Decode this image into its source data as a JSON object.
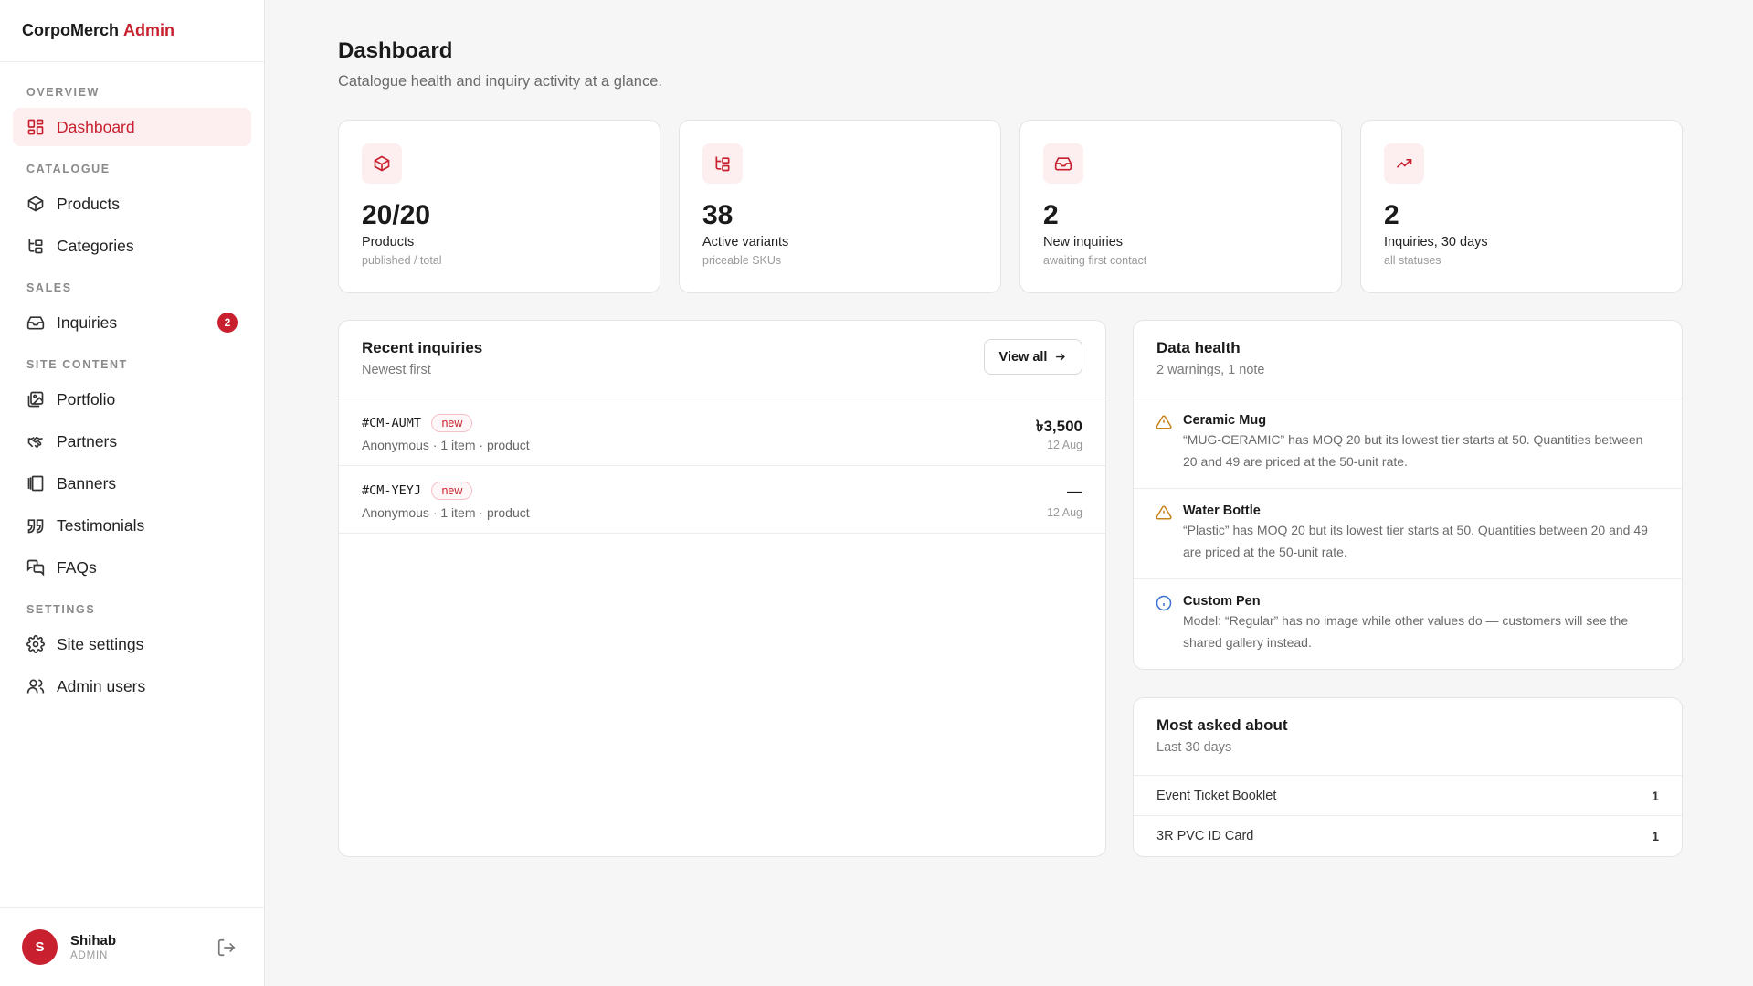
{
  "brand": {
    "name": "CorpoMerch",
    "accent": "Admin"
  },
  "sidebar": {
    "sections": [
      {
        "title": "OVERVIEW",
        "items": [
          {
            "label": "Dashboard",
            "icon": "dashboard-icon",
            "active": true
          }
        ]
      },
      {
        "title": "CATALOGUE",
        "items": [
          {
            "label": "Products",
            "icon": "box-icon"
          },
          {
            "label": "Categories",
            "icon": "tree-icon"
          }
        ]
      },
      {
        "title": "SALES",
        "items": [
          {
            "label": "Inquiries",
            "icon": "inbox-icon",
            "badge": "2"
          }
        ]
      },
      {
        "title": "SITE CONTENT",
        "items": [
          {
            "label": "Portfolio",
            "icon": "image-icon"
          },
          {
            "label": "Partners",
            "icon": "handshake-icon"
          },
          {
            "label": "Banners",
            "icon": "banner-icon"
          },
          {
            "label": "Testimonials",
            "icon": "quote-icon"
          },
          {
            "label": "FAQs",
            "icon": "chat-icon"
          }
        ]
      },
      {
        "title": "SETTINGS",
        "items": [
          {
            "label": "Site settings",
            "icon": "gear-icon"
          },
          {
            "label": "Admin users",
            "icon": "users-icon"
          }
        ]
      }
    ]
  },
  "user": {
    "initial": "S",
    "name": "Shihab",
    "role": "ADMIN"
  },
  "page": {
    "title": "Dashboard",
    "subtitle": "Catalogue health and inquiry activity at a glance."
  },
  "stats": [
    {
      "value": "20/20",
      "label": "Products",
      "hint": "published / total",
      "icon": "box-icon"
    },
    {
      "value": "38",
      "label": "Active variants",
      "hint": "priceable SKUs",
      "icon": "tree-icon"
    },
    {
      "value": "2",
      "label": "New inquiries",
      "hint": "awaiting first contact",
      "icon": "inbox-icon"
    },
    {
      "value": "2",
      "label": "Inquiries, 30 days",
      "hint": "all statuses",
      "icon": "trend-icon"
    }
  ],
  "recent": {
    "title": "Recent inquiries",
    "subtitle": "Newest first",
    "view_all": "View all",
    "rows": [
      {
        "code": "#CM-AUMT",
        "status": "new",
        "meta": "Anonymous · 1 item · product",
        "amount": "৳3,500",
        "date": "12 Aug"
      },
      {
        "code": "#CM-YEYJ",
        "status": "new",
        "meta": "Anonymous · 1 item · product",
        "amount": "—",
        "date": "12 Aug"
      }
    ]
  },
  "health": {
    "title": "Data health",
    "subtitle": "2 warnings, 1 note",
    "items": [
      {
        "kind": "warning",
        "title": "Ceramic Mug",
        "desc": "“MUG-CERAMIC” has MOQ 20 but its lowest tier starts at 50. Quantities between 20 and 49 are priced at the 50-unit rate."
      },
      {
        "kind": "warning",
        "title": "Water Bottle",
        "desc": "“Plastic” has MOQ 20 but its lowest tier starts at 50. Quantities between 20 and 49 are priced at the 50-unit rate."
      },
      {
        "kind": "info",
        "title": "Custom Pen",
        "desc": "Model: “Regular” has no image while other values do — customers will see the shared gallery instead."
      }
    ]
  },
  "asked": {
    "title": "Most asked about",
    "subtitle": "Last 30 days",
    "rows": [
      {
        "name": "Event Ticket Booklet",
        "count": "1"
      },
      {
        "name": "3R PVC ID Card",
        "count": "1"
      }
    ]
  },
  "colors": {
    "accent": "#c8202f",
    "accent_soft": "#fdeef0",
    "warning": "#c8821a",
    "info": "#3b6fd1"
  }
}
